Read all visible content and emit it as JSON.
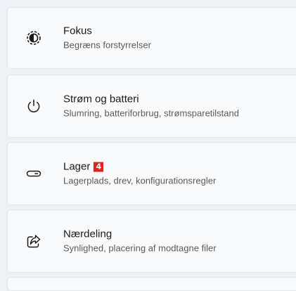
{
  "settings": {
    "items": [
      {
        "title": "Fokus",
        "subtitle": "Begræns forstyrrelser",
        "icon": "focus-icon"
      },
      {
        "title": "Strøm og batteri",
        "subtitle": "Slumring, batteriforbrug, strømsparetilstand",
        "icon": "power-icon"
      },
      {
        "title": "Lager",
        "subtitle": "Lagerplads, drev, konfigurationsregler",
        "icon": "storage-drive-icon",
        "badge": "4",
        "badge_color": "#e02222"
      },
      {
        "title": "Nærdeling",
        "subtitle": "Synlighed, placering af modtagne filer",
        "icon": "share-icon"
      }
    ]
  }
}
